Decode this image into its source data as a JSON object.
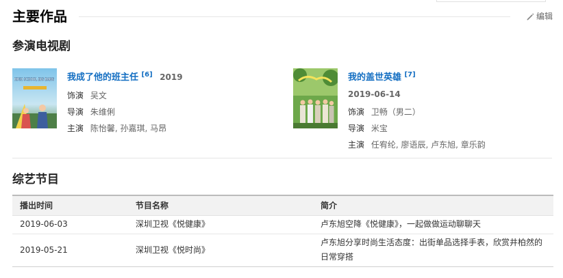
{
  "header": {
    "title": "主要作品",
    "edit_label": "编辑"
  },
  "tv_section": {
    "title": "参演电视剧",
    "works": [
      {
        "title": "我成了他的班主任",
        "ref": "[6]",
        "year": "2019",
        "date": "",
        "poster_text": "HIGH SCHOOL BIG BANG",
        "roles": [
          {
            "label": "饰演",
            "value": "吴文"
          },
          {
            "label": "导演",
            "value": "朱维俐"
          },
          {
            "label": "主演",
            "value": "陈怡馨, 孙嘉琪, 马昂"
          }
        ]
      },
      {
        "title": "我的盖世英雄",
        "ref": "[7]",
        "year": "",
        "date": "2019-06-14",
        "roles": [
          {
            "label": "饰演",
            "value": "卫畅（男二）"
          },
          {
            "label": "导演",
            "value": "米宝"
          },
          {
            "label": "主演",
            "value": "任宥纶, 廖语辰, 卢东旭, 章乐韵"
          }
        ]
      }
    ]
  },
  "variety_section": {
    "title": "综艺节目",
    "columns": [
      "播出时间",
      "节目名称",
      "简介"
    ],
    "rows": [
      {
        "date": "2019-06-03",
        "name": "深圳卫视《悦健康》",
        "desc": "卢东旭空降《悦健康》，一起做做运动聊聊天"
      },
      {
        "date": "2019-05-21",
        "name": "深圳卫视《悦时尚》",
        "desc": "卢东旭分享时尚生活态度：出街单品选择手表，欣赏井柏然的日常穿搭"
      }
    ]
  },
  "colors": {
    "link_blue": "#136ec2",
    "header_bg": "#f2f2f2",
    "rule": "#e6e6e6"
  }
}
